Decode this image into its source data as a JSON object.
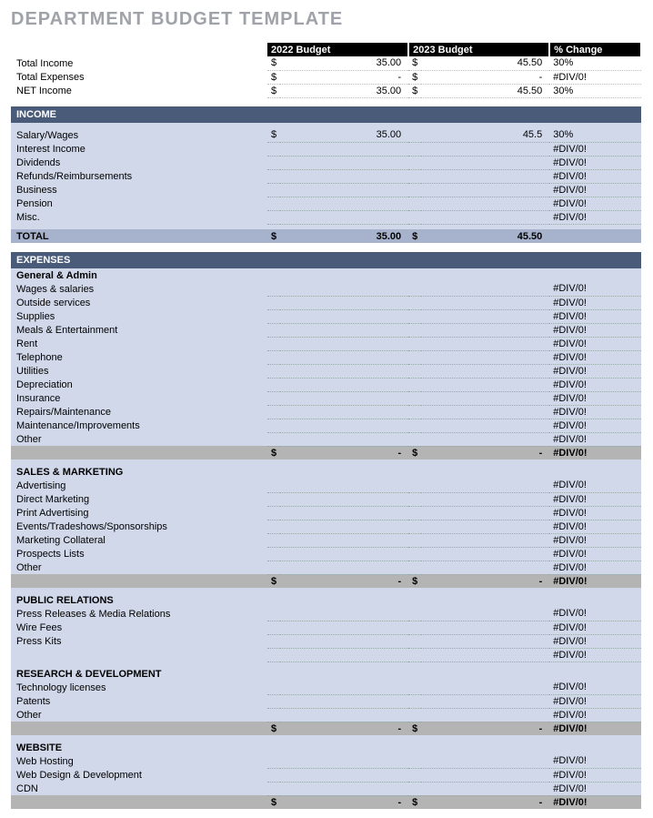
{
  "title": "DEPARTMENT BUDGET TEMPLATE",
  "headers": {
    "col1": "2022 Budget",
    "col2": "2023 Budget",
    "col3": "% Change"
  },
  "summary": [
    {
      "label": "Total Income",
      "sym1": "$",
      "v1": "35.00",
      "sym2": "$",
      "v2": "45.50",
      "pct": "30%"
    },
    {
      "label": "Total Expenses",
      "sym1": "$",
      "v1": "-",
      "sym2": "$",
      "v2": "-",
      "pct": "#DIV/0!"
    },
    {
      "label": "NET Income",
      "sym1": "$",
      "v1": "35.00",
      "sym2": "$",
      "v2": "45.50",
      "pct": "30%"
    }
  ],
  "income": {
    "title": "INCOME",
    "rows": [
      {
        "label": "Salary/Wages",
        "sym1": "$",
        "v1": "35.00",
        "sym2": "",
        "v2": "45.5",
        "pct": "30%"
      },
      {
        "label": "Interest Income",
        "sym1": "",
        "v1": "",
        "sym2": "",
        "v2": "",
        "pct": "#DIV/0!"
      },
      {
        "label": "Dividends",
        "sym1": "",
        "v1": "",
        "sym2": "",
        "v2": "",
        "pct": "#DIV/0!"
      },
      {
        "label": "Refunds/Reimbursements",
        "sym1": "",
        "v1": "",
        "sym2": "",
        "v2": "",
        "pct": "#DIV/0!"
      },
      {
        "label": "Business",
        "sym1": "",
        "v1": "",
        "sym2": "",
        "v2": "",
        "pct": "#DIV/0!"
      },
      {
        "label": "Pension",
        "sym1": "",
        "v1": "",
        "sym2": "",
        "v2": "",
        "pct": "#DIV/0!"
      },
      {
        "label": "Misc.",
        "sym1": "",
        "v1": "",
        "sym2": "",
        "v2": "",
        "pct": "#DIV/0!"
      }
    ],
    "total": {
      "label": "TOTAL",
      "sym1": "$",
      "v1": "35.00",
      "sym2": "$",
      "v2": "45.50",
      "pct": ""
    }
  },
  "expenses": {
    "title": "EXPENSES",
    "groups": [
      {
        "name": "General & Admin",
        "rows": [
          {
            "label": "Wages & salaries",
            "pct": "#DIV/0!"
          },
          {
            "label": "Outside services",
            "pct": "#DIV/0!"
          },
          {
            "label": "Supplies",
            "pct": "#DIV/0!"
          },
          {
            "label": "Meals & Entertainment",
            "pct": "#DIV/0!"
          },
          {
            "label": "Rent",
            "pct": "#DIV/0!"
          },
          {
            "label": "Telephone",
            "pct": "#DIV/0!"
          },
          {
            "label": "Utilities",
            "pct": "#DIV/0!"
          },
          {
            "label": "Depreciation",
            "pct": "#DIV/0!"
          },
          {
            "label": "Insurance",
            "pct": "#DIV/0!"
          },
          {
            "label": "Repairs/Maintenance",
            "pct": "#DIV/0!"
          },
          {
            "label": "Maintenance/Improvements",
            "pct": "#DIV/0!"
          },
          {
            "label": "Other",
            "pct": "#DIV/0!"
          }
        ],
        "subtotal": {
          "sym1": "$",
          "v1": "-",
          "sym2": "$",
          "v2": "-",
          "pct": "#DIV/0!"
        }
      },
      {
        "name": "SALES & MARKETING",
        "rows": [
          {
            "label": "Advertising",
            "pct": "#DIV/0!"
          },
          {
            "label": "Direct Marketing",
            "pct": "#DIV/0!"
          },
          {
            "label": "Print Advertising",
            "pct": "#DIV/0!"
          },
          {
            "label": "Events/Tradeshows/Sponsorships",
            "pct": "#DIV/0!"
          },
          {
            "label": "Marketing Collateral",
            "pct": "#DIV/0!"
          },
          {
            "label": "Prospects Lists",
            "pct": "#DIV/0!"
          },
          {
            "label": "Other",
            "pct": "#DIV/0!"
          }
        ],
        "subtotal": {
          "sym1": "$",
          "v1": "-",
          "sym2": "$",
          "v2": "-",
          "pct": "#DIV/0!"
        }
      },
      {
        "name": "PUBLIC RELATIONS",
        "rows": [
          {
            "label": "Press Releases & Media Relations",
            "pct": "#DIV/0!"
          },
          {
            "label": "Wire Fees",
            "pct": "#DIV/0!"
          },
          {
            "label": "Press Kits",
            "pct": "#DIV/0!"
          },
          {
            "label": "",
            "pct": "#DIV/0!"
          }
        ],
        "subtotal": null
      },
      {
        "name": "RESEARCH & DEVELOPMENT",
        "rows": [
          {
            "label": "Technology licenses",
            "pct": "#DIV/0!"
          },
          {
            "label": "Patents",
            "pct": "#DIV/0!"
          },
          {
            "label": "Other",
            "pct": "#DIV/0!"
          }
        ],
        "subtotal": {
          "sym1": "$",
          "v1": "-",
          "sym2": "$",
          "v2": "-",
          "pct": "#DIV/0!"
        }
      },
      {
        "name": "WEBSITE",
        "rows": [
          {
            "label": "Web Hosting",
            "pct": "#DIV/0!"
          },
          {
            "label": "Web Design & Development",
            "pct": "#DIV/0!"
          },
          {
            "label": "CDN",
            "pct": "#DIV/0!"
          }
        ],
        "subtotal": {
          "sym1": "$",
          "v1": "-",
          "sym2": "$",
          "v2": "-",
          "pct": "#DIV/0!"
        }
      }
    ]
  }
}
